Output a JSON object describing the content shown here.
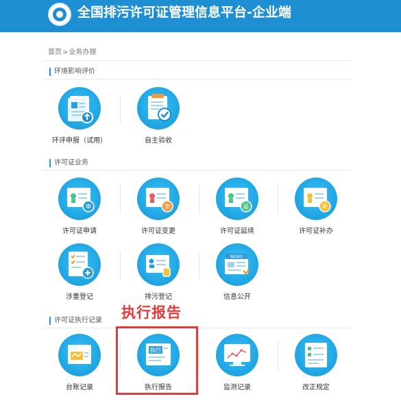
{
  "header": {
    "title": "全国排污许可证管理信息平台-企业端",
    "logo_icon": "emblem-icon"
  },
  "breadcrumb": {
    "home": "首页",
    "separator": ">",
    "current": "业务办理"
  },
  "sections": [
    {
      "title": "环境影响评价",
      "items": [
        {
          "label": "环评申报（试用）",
          "icon": "document-upload-icon"
        },
        {
          "label": "自主验收",
          "icon": "checklist-check-icon"
        }
      ]
    },
    {
      "title": "许可证业务",
      "items": [
        {
          "label": "许可证申请",
          "icon": "certificate-apply-icon",
          "badge": "申"
        },
        {
          "label": "许可证变更",
          "icon": "certificate-change-icon",
          "badge": "变"
        },
        {
          "label": "许可证延续",
          "icon": "certificate-extend-icon",
          "badge": "延"
        },
        {
          "label": "许可证补办",
          "icon": "certificate-reissue-icon",
          "badge": "补"
        },
        {
          "label": "涉重登记",
          "icon": "registration-list-icon"
        },
        {
          "label": "排污登记",
          "icon": "pollution-register-icon"
        },
        {
          "label": "信息公开",
          "icon": "news-icon",
          "badge": "NEWS"
        }
      ]
    },
    {
      "title": "许可证执行记录",
      "items": [
        {
          "label": "台账记录",
          "icon": "ledger-folder-icon"
        },
        {
          "label": "执行报告",
          "icon": "execution-report-icon",
          "badge": "执行"
        },
        {
          "label": "监测记录",
          "icon": "monitoring-chart-icon"
        },
        {
          "label": "改正规定",
          "icon": "correction-doc-icon"
        }
      ]
    }
  ],
  "annotation": {
    "text": "执行报告",
    "color": "#e23b3b"
  },
  "colors": {
    "header": "#1e8fd2",
    "tile": "#1ea3e3",
    "accent_orange": "#f39a3a",
    "highlight": "#e23b3b"
  }
}
